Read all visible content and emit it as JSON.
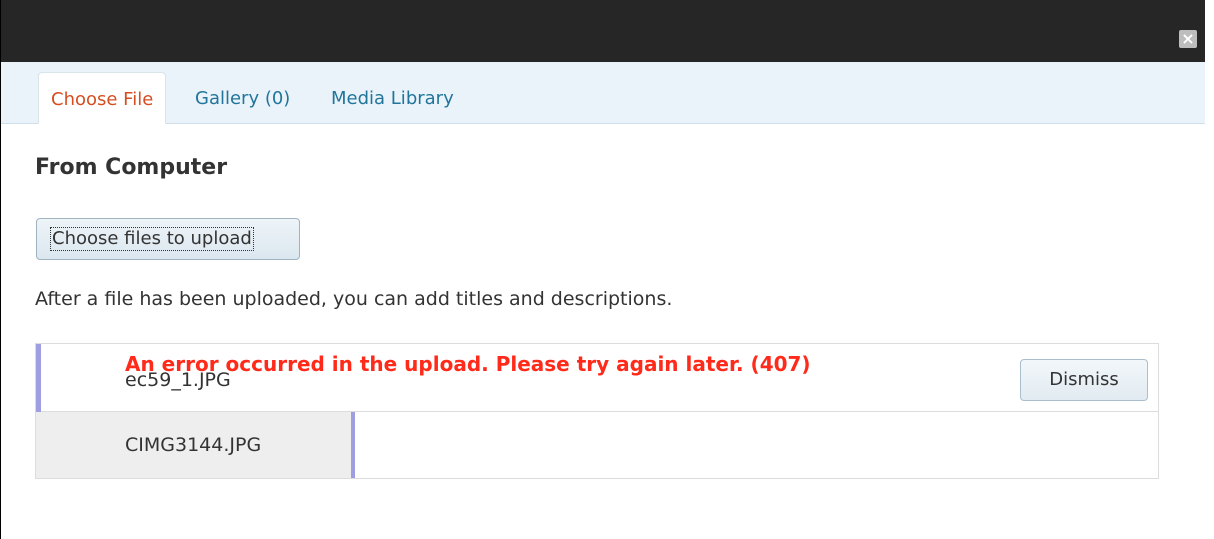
{
  "dialog": {
    "close_label": "×"
  },
  "tabs": [
    {
      "label": "Choose File",
      "active": true
    },
    {
      "label": "Gallery (0)",
      "active": false
    },
    {
      "label": "Media Library",
      "active": false
    }
  ],
  "main": {
    "heading": "From Computer",
    "upload_button_label": "Choose files to upload",
    "info_text": "After a file has been uploaded, you can add titles and descriptions."
  },
  "queue": {
    "items": [
      {
        "filename": "ec59_1.JPG",
        "error": "An error occurred in the upload. Please try again later. (407)",
        "dismiss_label": "Dismiss"
      },
      {
        "filename": "CIMG3144.JPG"
      }
    ]
  },
  "colors": {
    "titlebar": "#262626",
    "tabbar": "#eaf3fa",
    "active_tab_text": "#d54e21",
    "tab_text": "#21759b",
    "error_text": "#ff2a1a",
    "progress_accent": "#9e9ee0"
  }
}
